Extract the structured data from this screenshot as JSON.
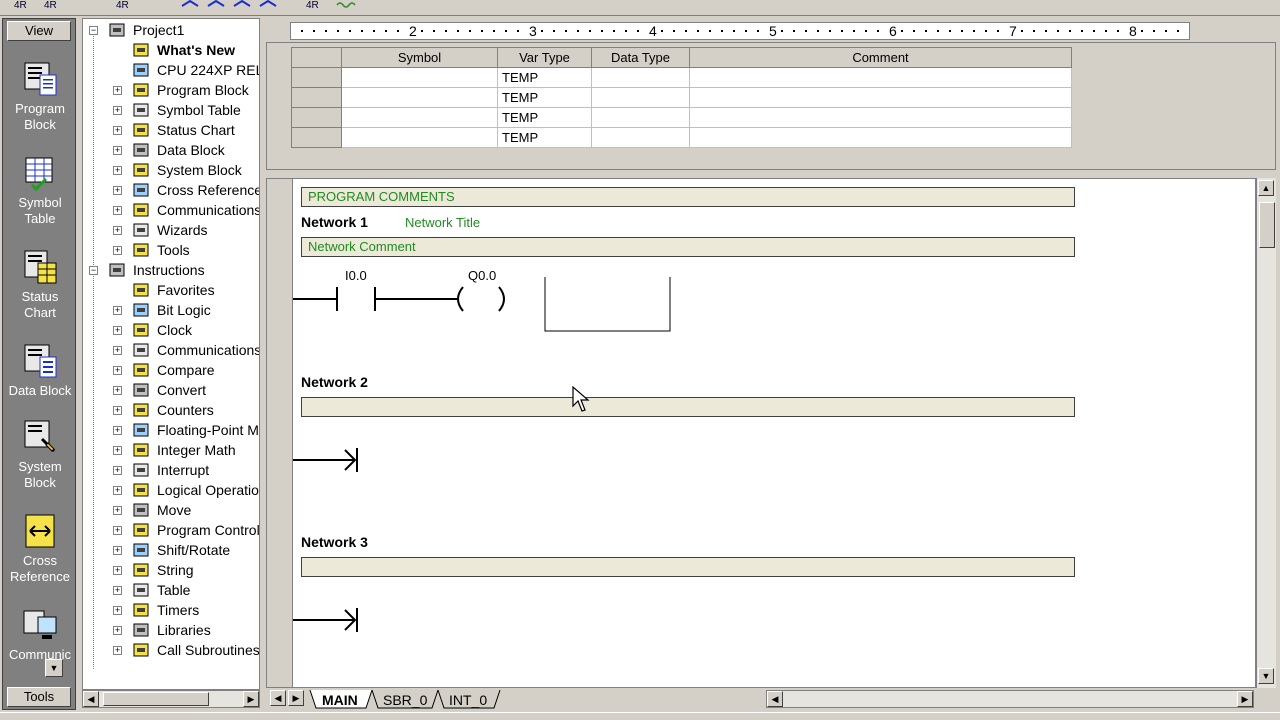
{
  "toolbar": {
    "label_a": "4R",
    "label_b": "4R",
    "label_c": "4R",
    "label_d": "4R"
  },
  "navbar": {
    "header": "View",
    "footer": "Tools",
    "items": [
      {
        "line1": "Program",
        "line2": "Block",
        "icon": "program-block-icon"
      },
      {
        "line1": "Symbol",
        "line2": "Table",
        "icon": "symbol-table-icon"
      },
      {
        "line1": "Status",
        "line2": "Chart",
        "icon": "status-chart-icon"
      },
      {
        "line1": "Data Block",
        "line2": "",
        "icon": "data-block-icon"
      },
      {
        "line1": "System",
        "line2": "Block",
        "icon": "system-block-icon"
      },
      {
        "line1": "Cross",
        "line2": "Reference",
        "icon": "cross-reference-icon"
      },
      {
        "line1": "Communic",
        "line2": "",
        "icon": "communications-icon"
      }
    ]
  },
  "tree": {
    "items": [
      {
        "label": "Project1",
        "level": 0,
        "expander": "−"
      },
      {
        "label": "What's New",
        "level": 1,
        "expander": "",
        "bold": true
      },
      {
        "label": "CPU 224XP REL",
        "level": 1,
        "expander": ""
      },
      {
        "label": "Program Block",
        "level": 1,
        "expander": "+"
      },
      {
        "label": "Symbol Table",
        "level": 1,
        "expander": "+"
      },
      {
        "label": "Status Chart",
        "level": 1,
        "expander": "+"
      },
      {
        "label": "Data Block",
        "level": 1,
        "expander": "+"
      },
      {
        "label": "System Block",
        "level": 1,
        "expander": "+"
      },
      {
        "label": "Cross Reference",
        "level": 1,
        "expander": "+"
      },
      {
        "label": "Communications",
        "level": 1,
        "expander": "+"
      },
      {
        "label": "Wizards",
        "level": 1,
        "expander": "+"
      },
      {
        "label": "Tools",
        "level": 1,
        "expander": "+"
      },
      {
        "label": "Instructions",
        "level": 0,
        "expander": "−"
      },
      {
        "label": "Favorites",
        "level": 1,
        "expander": ""
      },
      {
        "label": "Bit Logic",
        "level": 1,
        "expander": "+"
      },
      {
        "label": "Clock",
        "level": 1,
        "expander": "+"
      },
      {
        "label": "Communications",
        "level": 1,
        "expander": "+"
      },
      {
        "label": "Compare",
        "level": 1,
        "expander": "+"
      },
      {
        "label": "Convert",
        "level": 1,
        "expander": "+"
      },
      {
        "label": "Counters",
        "level": 1,
        "expander": "+"
      },
      {
        "label": "Floating-Point Ma",
        "level": 1,
        "expander": "+"
      },
      {
        "label": "Integer Math",
        "level": 1,
        "expander": "+"
      },
      {
        "label": "Interrupt",
        "level": 1,
        "expander": "+"
      },
      {
        "label": "Logical Operatior",
        "level": 1,
        "expander": "+"
      },
      {
        "label": "Move",
        "level": 1,
        "expander": "+"
      },
      {
        "label": "Program Control",
        "level": 1,
        "expander": "+"
      },
      {
        "label": "Shift/Rotate",
        "level": 1,
        "expander": "+"
      },
      {
        "label": "String",
        "level": 1,
        "expander": "+"
      },
      {
        "label": "Table",
        "level": 1,
        "expander": "+"
      },
      {
        "label": "Timers",
        "level": 1,
        "expander": "+"
      },
      {
        "label": "Libraries",
        "level": 1,
        "expander": "+"
      },
      {
        "label": "Call Subroutines",
        "level": 1,
        "expander": "+"
      }
    ]
  },
  "ruler": {
    "numbers": [
      "2",
      "3",
      "4",
      "5",
      "6",
      "7",
      "8"
    ]
  },
  "vartable": {
    "headers": [
      "Symbol",
      "Var Type",
      "Data Type",
      "Comment"
    ],
    "rows": [
      [
        "",
        "TEMP",
        "",
        ""
      ],
      [
        "",
        "TEMP",
        "",
        ""
      ],
      [
        "",
        "TEMP",
        "",
        ""
      ],
      [
        "",
        "TEMP",
        "",
        ""
      ]
    ]
  },
  "editor": {
    "program_comments": "PROGRAM COMMENTS",
    "networks": [
      {
        "title": "Network 1",
        "subtitle": "Network Title",
        "comment": "Network Comment",
        "contact": "I0.0",
        "coil": "Q0.0"
      },
      {
        "title": "Network 2",
        "subtitle": "",
        "comment": ""
      },
      {
        "title": "Network 3",
        "subtitle": "",
        "comment": ""
      }
    ]
  },
  "tabs": [
    "MAIN",
    "SBR_0",
    "INT_0"
  ]
}
